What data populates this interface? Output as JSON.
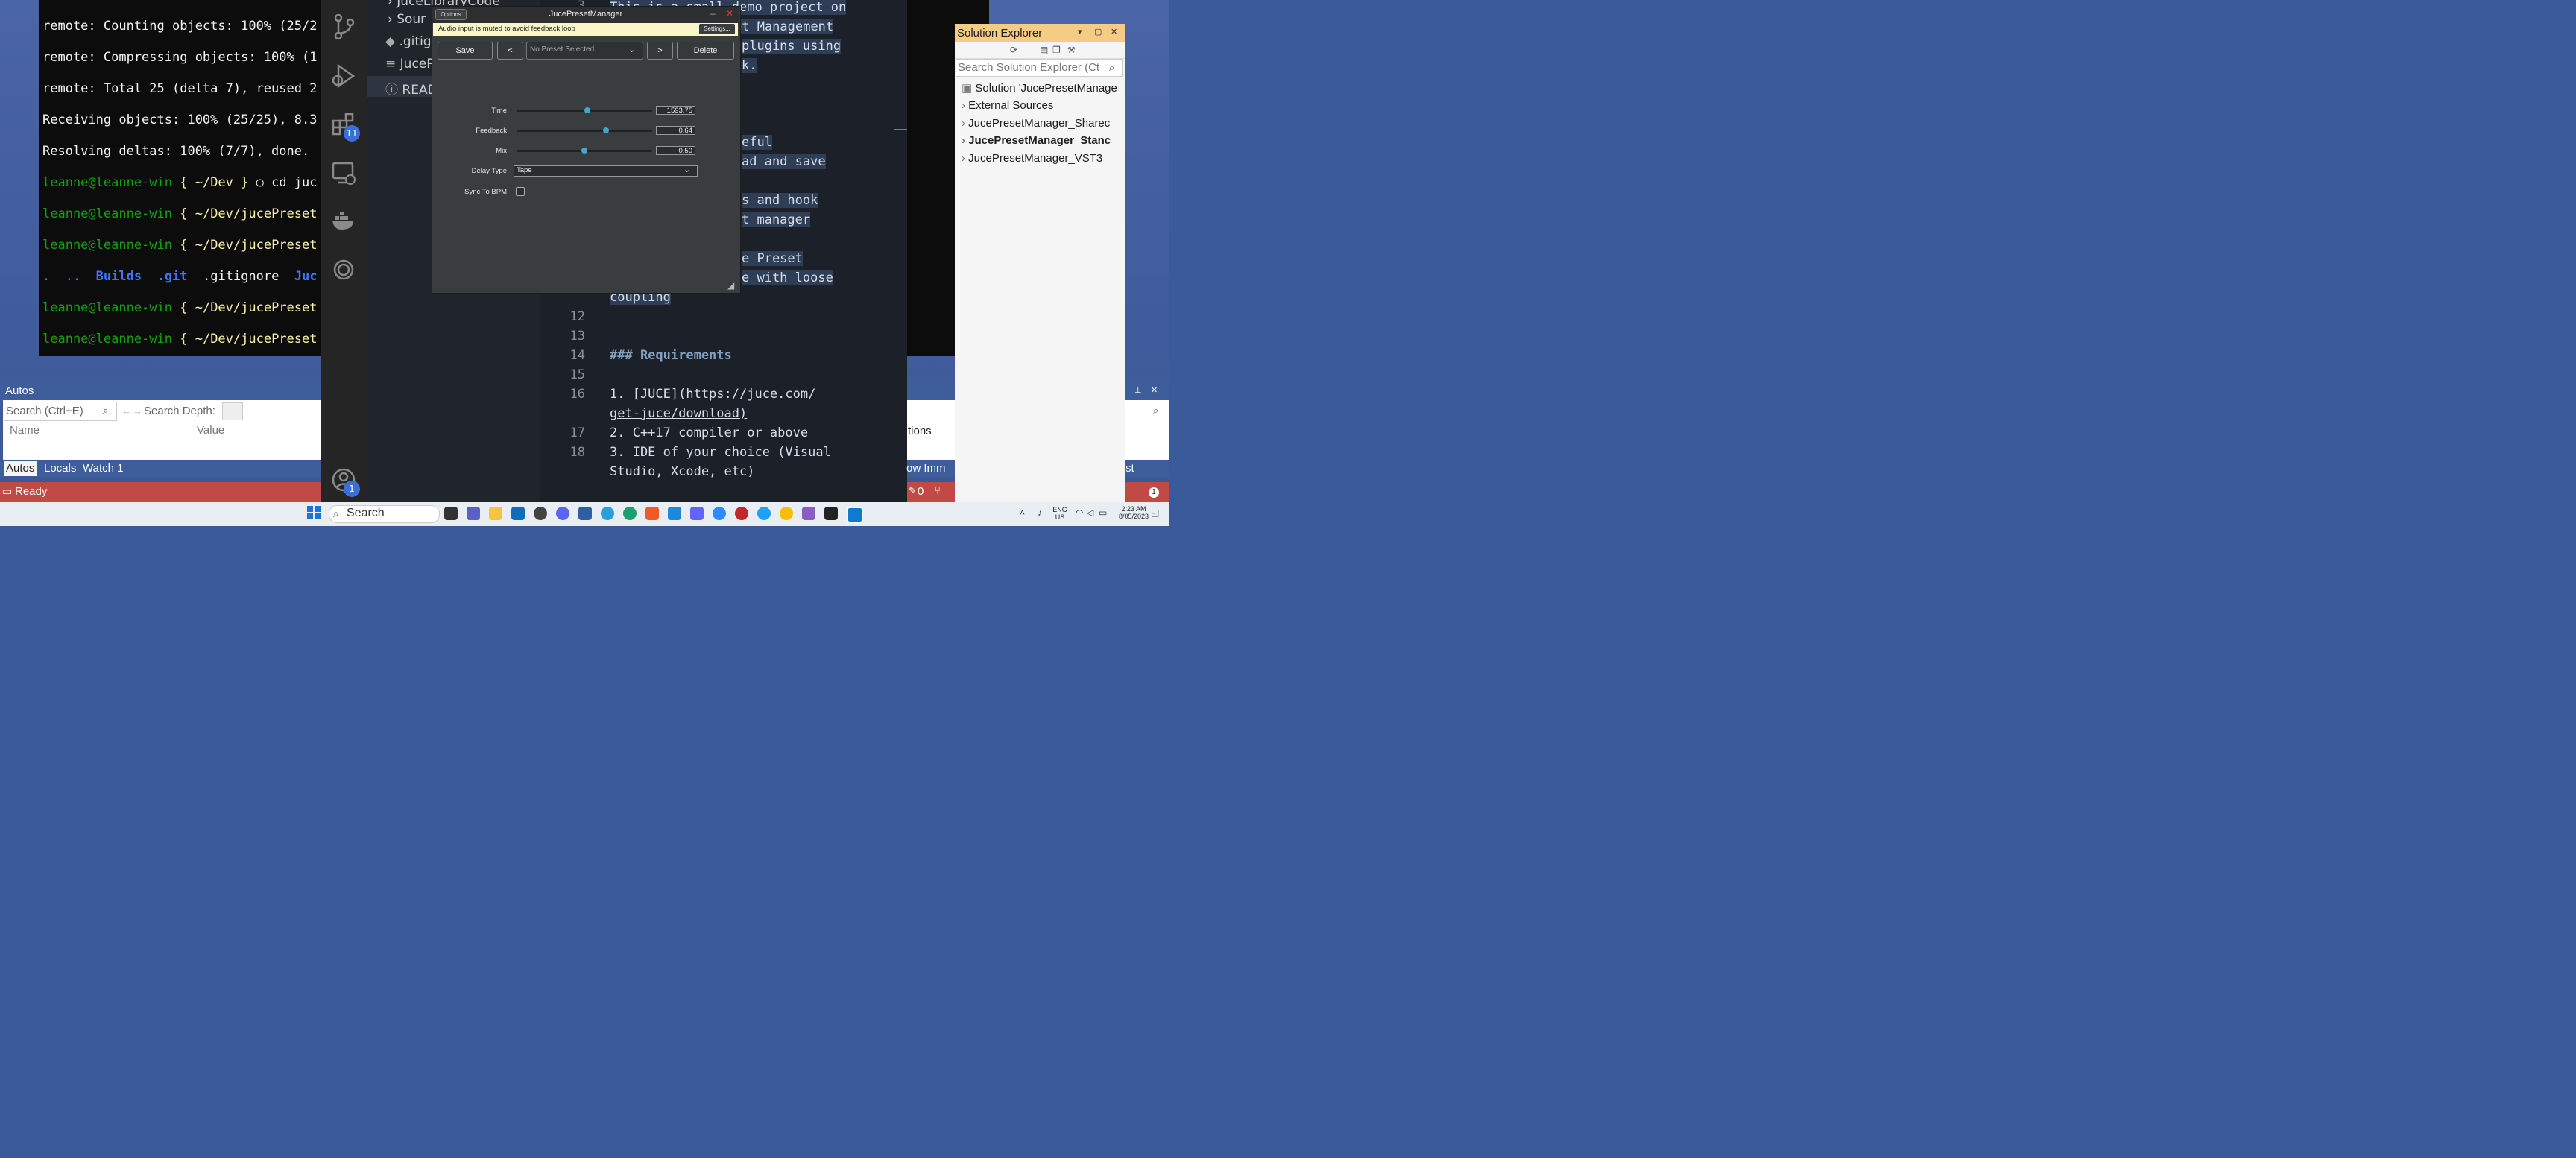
{
  "terminal": {
    "lines": [
      "remote: Counting objects: 100% (25/2",
      "remote: Compressing objects: 100% (1",
      "remote: Total 25 (delta 7), reused 2",
      "Receiving objects: 100% (25/25), 8.3",
      "Resolving deltas: 100% (7/7), done."
    ],
    "prompts": [
      {
        "user": "leanne@leanne-win",
        "path": "{ ~/Dev } ",
        "cmd": "○ cd juc"
      },
      {
        "user": "leanne@leanne-win",
        "path": "{ ~/Dev/jucePreset",
        "cmd": ""
      },
      {
        "user": "leanne@leanne-win",
        "path": "{ ~/Dev/jucePreset",
        "cmd": ""
      }
    ],
    "ls_line": {
      "dots": ".  ..",
      "builds": "Builds",
      "git": ".git",
      "gitignore": ".gitignore",
      "juc": "Juc"
    },
    "prompts2": [
      {
        "user": "leanne@leanne-win",
        "path": "{ ~/Dev/jucePreset"
      },
      {
        "user": "leanne@leanne-win",
        "path": "{ ~/Dev/jucePreset"
      }
    ]
  },
  "vscode": {
    "badges": {
      "extensions": "11",
      "account": "1"
    },
    "explorer": {
      "items": [
        "JuceLibraryCode",
        "Sour",
        ".gitig",
        "JuceP",
        "READ"
      ]
    },
    "editor": {
      "lines": [
        {
          "n": "3",
          "text": "This is a small demo project on"
        },
        {
          "n": "",
          "text": "et Management"
        },
        {
          "n": "",
          "text": "plugins using"
        },
        {
          "n": "",
          "text": "k."
        },
        {
          "n": "",
          "text": "eful"
        },
        {
          "n": "",
          "text": "ad and save"
        },
        {
          "n": "",
          "text": "s and hook"
        },
        {
          "n": "",
          "text": "t manager"
        },
        {
          "n": "",
          "text": "e Preset"
        },
        {
          "n": "",
          "text": "e with loose"
        },
        {
          "n": "",
          "text": "coupling"
        },
        {
          "n": "12",
          "text": ""
        },
        {
          "n": "13",
          "text": ""
        },
        {
          "n": "14",
          "text": "### Requirements"
        },
        {
          "n": "15",
          "text": ""
        },
        {
          "n": "16a",
          "text": "1. [JUCE](https://juce.com/"
        },
        {
          "n": "16b",
          "text": "get-juce/download)"
        },
        {
          "n": "17",
          "text": "2. C++17 compiler or above"
        },
        {
          "n": "18a",
          "text": "3. IDE of your choice (Visual"
        },
        {
          "n": "18b",
          "text": "Studio, Xcode, etc)"
        }
      ],
      "line_numbers": {
        "l12": "12",
        "l13": "13",
        "l14": "14",
        "l15": "15",
        "l16": "16",
        "l17": "17",
        "l18": "18"
      }
    }
  },
  "plugin": {
    "title": "JucePresetManager",
    "options_label": "Options",
    "mute_message": "Audio input is muted to avoid feedback loop",
    "settings_label": "Settings...",
    "save_label": "Save",
    "prev_label": "<",
    "next_label": ">",
    "preset_selected": "No Preset Selected",
    "delete_label": "Delete",
    "params": [
      {
        "label": "Time",
        "value": "1593.75",
        "fraction": 0.52
      },
      {
        "label": "Feedback",
        "value": "0.64",
        "fraction": 0.66
      },
      {
        "label": "Mix",
        "value": "0.50",
        "fraction": 0.5
      }
    ],
    "delay_type_label": "Delay Type",
    "delay_type_value": "Tape",
    "sync_label": "Sync To BPM",
    "sync_checked": false
  },
  "solution_explorer": {
    "title": "Solution Explorer",
    "search_placeholder": "Search Solution Explorer (Ct",
    "items": [
      "Solution 'JucePresetManage",
      "External Sources",
      "JucePresetManager_Sharec",
      "JucePresetManager_Stanc",
      "JucePresetManager_VST3"
    ]
  },
  "autos": {
    "title": "Autos",
    "search_placeholder": "Search (Ctrl+E)",
    "depth_label": "Search Depth:",
    "col_name": "Name",
    "col_value": "Value",
    "tabs": [
      "Autos",
      "Locals",
      "Watch 1"
    ],
    "right_col": "tions",
    "right_tabs": "ow  Imm"
  },
  "status": {
    "text": "Ready",
    "right_text": "0",
    "right_tab": "st"
  },
  "taskbar": {
    "search_label": "Search",
    "lang": "ENG",
    "region": "US",
    "time": "2:23 AM",
    "date": "8/05/2023",
    "notification_count": "1"
  }
}
